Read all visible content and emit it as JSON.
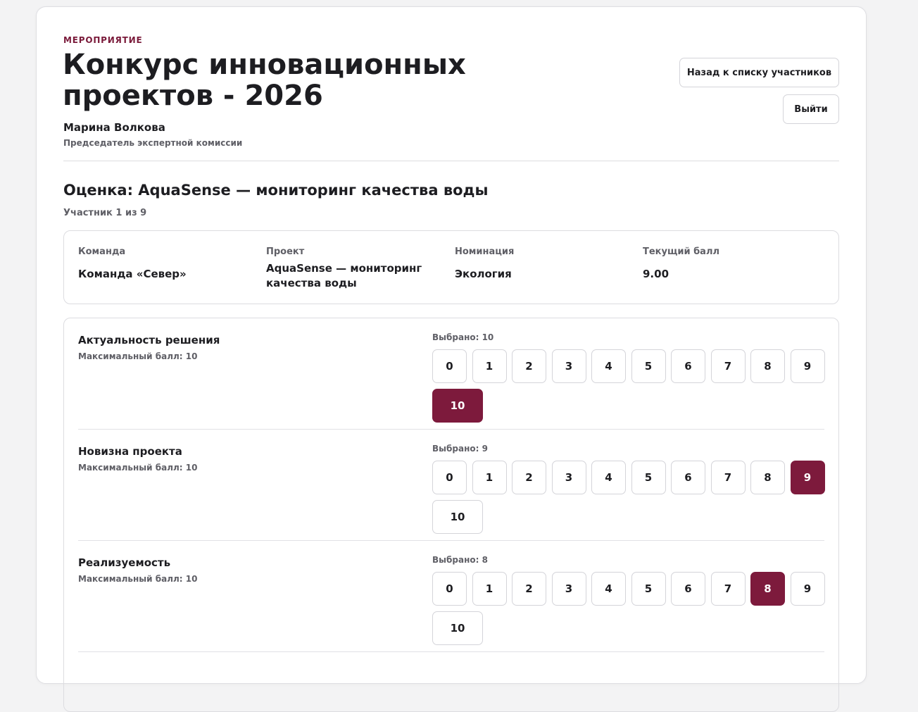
{
  "header": {
    "eyebrow": "МЕРОПРИЯТИЕ",
    "title": "Конкурс инновационных проектов - 2026",
    "user_name": "Марина Волкова",
    "user_role": "Председатель экспертной комиссии",
    "back_button": "Назад к списку участников",
    "logout_button": "Выйти"
  },
  "evaluation": {
    "title": "Оценка: AquaSense — мониторинг качества воды",
    "progress": "Участник 1 из 9"
  },
  "info": [
    {
      "label": "Команда",
      "value": "Команда «Север»"
    },
    {
      "label": "Проект",
      "value": "AquaSense — мониторинг качества воды"
    },
    {
      "label": "Номинация",
      "value": "Экология"
    },
    {
      "label": "Текущий балл",
      "value": "9.00"
    }
  ],
  "scores": [
    "0",
    "1",
    "2",
    "3",
    "4",
    "5",
    "6",
    "7",
    "8",
    "9",
    "10"
  ],
  "criteria": [
    {
      "name": "Актуальность решения",
      "max": "Максимальный балл: 10",
      "selected_text": "Выбрано: 10",
      "selected": 10
    },
    {
      "name": "Новизна проекта",
      "max": "Максимальный балл: 10",
      "selected_text": "Выбрано: 9",
      "selected": 9
    },
    {
      "name": "Реализуемость",
      "max": "Максимальный балл: 10",
      "selected_text": "Выбрано: 8",
      "selected": 8
    }
  ],
  "colors": {
    "accent": "#7d1a3c",
    "eyebrow": "#7a1a3a",
    "border": "#dcdce0",
    "muted_text": "#5f5f66"
  }
}
